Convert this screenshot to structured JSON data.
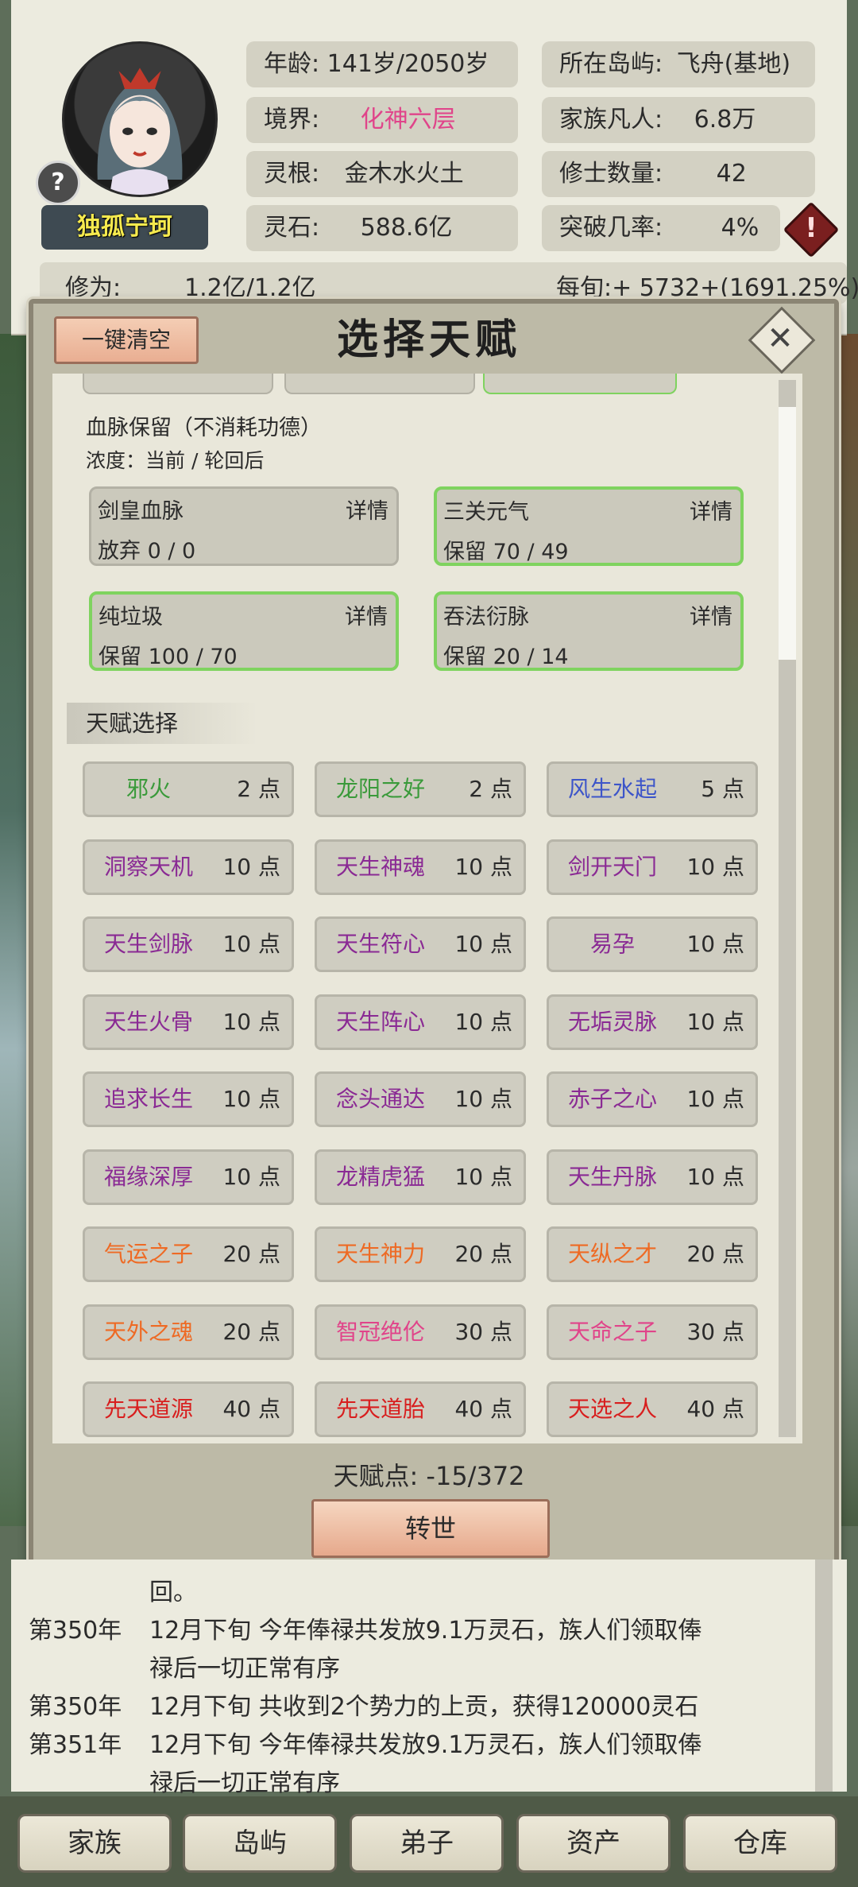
{
  "character": {
    "name": "独孤宁珂",
    "age_label": "年龄:",
    "age_value": "141岁/2050岁",
    "realm_label": "境界:",
    "realm_value": "化神六层",
    "root_label": "灵根:",
    "root_value": "金木水火土",
    "stone_label": "灵石:",
    "stone_value": "588.6亿",
    "island_label": "所在岛屿:",
    "island_value": "飞舟(基地)",
    "mortals_label": "家族凡人:",
    "mortals_value": "6.8万",
    "cultivators_label": "修士数量:",
    "cultivators_value": "42",
    "breakthrough_label": "突破几率:",
    "breakthrough_value": "4%",
    "cultivation_label": "修为:",
    "cultivation_value": "1.2亿/1.2亿",
    "income": "每旬:+ 5732+(1691.25%)",
    "help_glyph": "?",
    "warn_glyph": "!",
    "colors": {
      "realm": "#e0448a",
      "name": "#f6ea4e"
    }
  },
  "dialog": {
    "clear_button": "一键清空",
    "title": "选择天赋",
    "close_glyph": "✕",
    "bloodline_title": "血脉保留（不消耗功德）",
    "bloodline_subtitle": "浓度：当前 / 轮回后",
    "bloodlines": [
      {
        "name": "剑皇血脉",
        "detail": "详情",
        "status": "放弃  0 / 0",
        "kept": false
      },
      {
        "name": "三关元气",
        "detail": "详情",
        "status": "保留  70 / 49",
        "kept": true
      },
      {
        "name": "纯垃圾",
        "detail": "详情",
        "status": "保留  100 / 70",
        "kept": true
      },
      {
        "name": "吞法衍脉",
        "detail": "详情",
        "status": "保留  20 / 14",
        "kept": true
      }
    ],
    "talent_section": "天赋选择",
    "talents": [
      {
        "name": "邪火",
        "cost": "2 点",
        "color": "#3a9a3a"
      },
      {
        "name": "龙阳之好",
        "cost": "2 点",
        "color": "#3a9a3a"
      },
      {
        "name": "风生水起",
        "cost": "5 点",
        "color": "#3d55c9"
      },
      {
        "name": "洞察天机",
        "cost": "10 点",
        "color": "#8a2a94"
      },
      {
        "name": "天生神魂",
        "cost": "10 点",
        "color": "#8a2a94"
      },
      {
        "name": "剑开天门",
        "cost": "10 点",
        "color": "#8a2a94"
      },
      {
        "name": "天生剑脉",
        "cost": "10 点",
        "color": "#8a2a94"
      },
      {
        "name": "天生符心",
        "cost": "10 点",
        "color": "#8a2a94"
      },
      {
        "name": "易孕",
        "cost": "10 点",
        "color": "#8a2a94"
      },
      {
        "name": "天生火骨",
        "cost": "10 点",
        "color": "#8a2a94"
      },
      {
        "name": "天生阵心",
        "cost": "10 点",
        "color": "#8a2a94"
      },
      {
        "name": "无垢灵脉",
        "cost": "10 点",
        "color": "#8a2a94"
      },
      {
        "name": "追求长生",
        "cost": "10 点",
        "color": "#8a2a94"
      },
      {
        "name": "念头通达",
        "cost": "10 点",
        "color": "#8a2a94"
      },
      {
        "name": "赤子之心",
        "cost": "10 点",
        "color": "#8a2a94"
      },
      {
        "name": "福缘深厚",
        "cost": "10 点",
        "color": "#8a2a94"
      },
      {
        "name": "龙精虎猛",
        "cost": "10 点",
        "color": "#8a2a94"
      },
      {
        "name": "天生丹脉",
        "cost": "10 点",
        "color": "#8a2a94"
      },
      {
        "name": "气运之子",
        "cost": "20 点",
        "color": "#ee6a24"
      },
      {
        "name": "天生神力",
        "cost": "20 点",
        "color": "#ee6a24"
      },
      {
        "name": "天纵之才",
        "cost": "20 点",
        "color": "#ee6a24"
      },
      {
        "name": "天外之魂",
        "cost": "20 点",
        "color": "#ee6a24"
      },
      {
        "name": "智冠绝伦",
        "cost": "30 点",
        "color": "#e0448a"
      },
      {
        "name": "天命之子",
        "cost": "30 点",
        "color": "#e0448a"
      },
      {
        "name": "先天道源",
        "cost": "40 点",
        "color": "#d81e1e"
      },
      {
        "name": "先天道胎",
        "cost": "40 点",
        "color": "#d81e1e"
      },
      {
        "name": "天选之人",
        "cost": "40 点",
        "color": "#d81e1e"
      }
    ],
    "talent_points": "天赋点:  -15/372",
    "reincarnate_button": "转世"
  },
  "log": [
    {
      "year": "",
      "text": "回。"
    },
    {
      "year": "第350年",
      "text": "12月下旬 今年俸禄共发放9.1万灵石，族人们领取俸"
    },
    {
      "year": "",
      "text": "禄后一切正常有序"
    },
    {
      "year": "第350年",
      "text": "12月下旬 共收到2个势力的上贡，获得120000灵石"
    },
    {
      "year": "第351年",
      "text": "12月下旬 今年俸禄共发放9.1万灵石，族人们领取俸"
    },
    {
      "year": "",
      "text": "禄后一切正常有序"
    }
  ],
  "tabs": [
    "家族",
    "岛屿",
    "弟子",
    "资产",
    "仓库"
  ]
}
